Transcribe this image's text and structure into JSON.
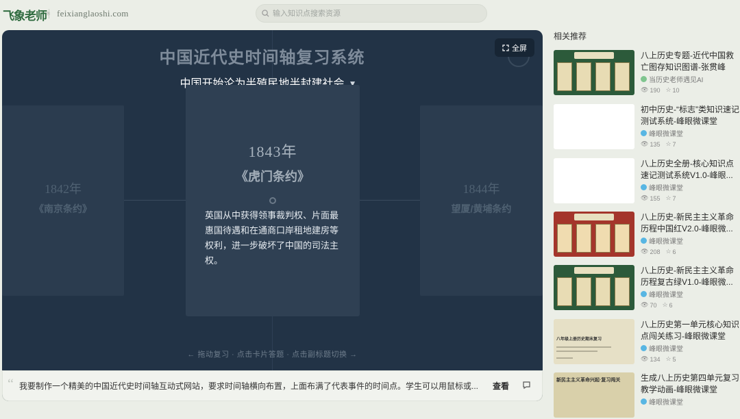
{
  "header": {
    "logo": "飞象老师",
    "logo_mark": "®",
    "domain": "feixianglaoshi.com",
    "search_placeholder": "输入知识点搜索资源"
  },
  "stage": {
    "title": "中国近代史时间轴复习系统",
    "fullscreen_label": "全屏",
    "subtitle": "中国开始沦为半殖民地半封建社会",
    "cards": {
      "left": {
        "year": "1842年",
        "event": "《南京条约》"
      },
      "center": {
        "year": "1843年",
        "event": "《虎门条约》",
        "desc": "英国从中获得领事裁判权、片面最惠国待遇和在通商口岸租地建房等权利，进一步破坏了中国的司法主权。"
      },
      "right": {
        "year": "1844年",
        "event": "望厦/黄埔条约"
      }
    },
    "hint": "← 拖动复习 · 点击卡片答题 · 点击副标题切换 →"
  },
  "prompt": {
    "text": "我要制作一个精美的中国近代史时间轴互动式网站，要求时间轴横向布置，上面布满了代表事件的时间点。学生可以用鼠标或...",
    "view_label": "查看"
  },
  "sidebar": {
    "title": "相关推荐",
    "items": [
      {
        "title": "八上历史专题-近代中国救亡图存知识图谱-张贯峰",
        "author": "当历史老师遇见AI",
        "views": "190",
        "likes": "10"
      },
      {
        "title": "初中历史-“标志”类知识速记测试系统-峰眼微课堂",
        "author": "峰眼微课堂",
        "views": "135",
        "likes": "7"
      },
      {
        "title": "八上历史全册-核心知识点速记测试系统V1.0-峰眼...",
        "author": "峰眼微课堂",
        "views": "155",
        "likes": "7"
      },
      {
        "title": "八上历史-新民主主义革命历程中国红V2.0-峰眼微...",
        "author": "峰眼微课堂",
        "views": "208",
        "likes": "6"
      },
      {
        "title": "八上历史-新民主主义革命历程复古绿V1.0-峰眼微...",
        "author": "峰眼微课堂",
        "views": "70",
        "likes": "6"
      },
      {
        "title": "八上历史第一单元核心知识点闯关练习-峰眼微课堂",
        "author": "峰眼微课堂",
        "views": "134",
        "likes": "5"
      },
      {
        "title": "生成八上历史第四单元复习教学动画-峰眼微课堂",
        "author": "峰眼微课堂"
      }
    ],
    "thumb_texts": {
      "paper_title": "八年级上册历史期末复习",
      "beige_title": "新民主主义革命兴起·复习闯关"
    }
  }
}
